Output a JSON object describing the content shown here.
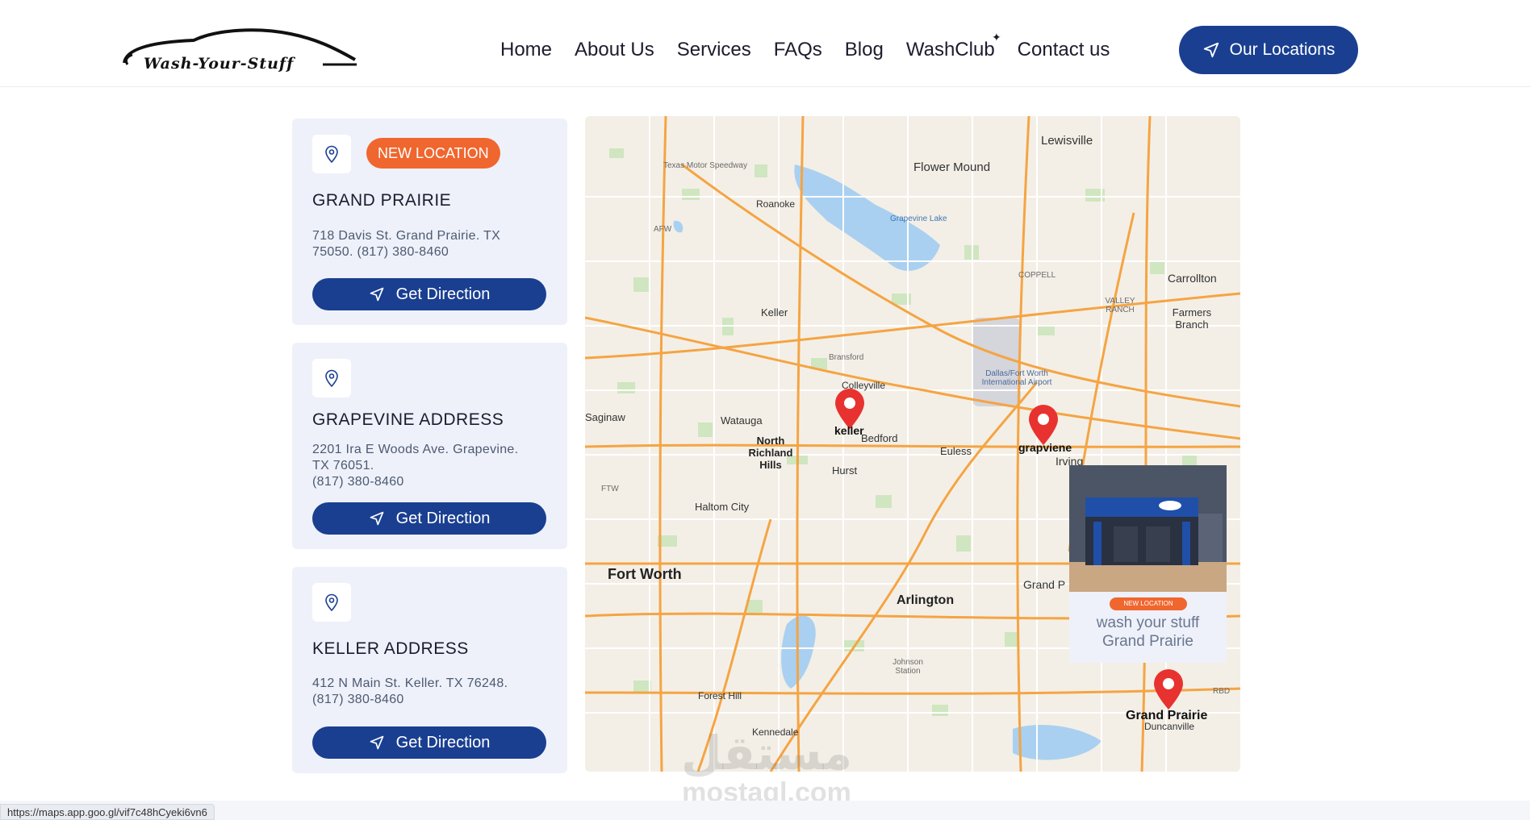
{
  "brand": {
    "logo_text": "Wash-Your-Stuff"
  },
  "nav": {
    "items": [
      "Home",
      "About Us",
      "Services",
      "FAQs",
      "Blog",
      "WashClub",
      "Contact us"
    ],
    "cta_label": "Our Locations"
  },
  "colors": {
    "primary": "#1a3f91",
    "accent": "#f0662f",
    "card_bg": "#eef1f9"
  },
  "locations": [
    {
      "badge": "NEW LOCATION",
      "title": "GRAND PRAIRIE",
      "address_lines": [
        "718 Davis St. Grand Prairie. TX",
        "75050. (817) 380-8460"
      ],
      "button_label": "Get Direction"
    },
    {
      "title": "GRAPEVINE ADDRESS",
      "address_lines": [
        "2201 Ira E Woods Ave. Grapevine.",
        "TX 76051.",
        "(817) 380-8460"
      ],
      "button_label": "Get Direction"
    },
    {
      "title": "KELLER ADDRESS",
      "address_lines": [
        "412 N Main St. Keller. TX 76248.",
        "(817) 380-8460"
      ],
      "button_label": "Get Direction"
    }
  ],
  "map": {
    "cities": {
      "lewisville": "Lewisville",
      "flower_mound": "Flower Mound",
      "roanoke": "Roanoke",
      "texas_motor": "Texas Motor Speedway",
      "grapevine_lake": "Grapevine Lake",
      "afw": "AFW",
      "coppell": "COPPELL",
      "carrollton": "Carrollton",
      "valley_ranch": "VALLEY RANCH",
      "farmers_branch": "Farmers Branch",
      "keller": "Keller",
      "bransford": "Bransford",
      "colleyville": "Colleyville",
      "dfw_airport": "Dallas/Fort Worth International Airport",
      "saginaw": "Saginaw",
      "watauga": "Watauga",
      "bedford": "Bedford",
      "euless": "Euless",
      "irving": "Irving",
      "north_richland_hills": "North Richland Hills",
      "hurst": "Hurst",
      "ftw": "FTW",
      "haltom_city": "Haltom City",
      "fort_worth": "Fort Worth",
      "grand_prairie_city": "Grand P",
      "arlington": "Arlington",
      "johnson_station": "Johnson Station",
      "forest_hill": "Forest Hill",
      "kennedale": "Kennedale",
      "rbd": "RBD",
      "duncanville": "Duncanville"
    },
    "markers": {
      "keller": "keller",
      "grapevine": "grapviene",
      "grand_prairie": "Grand Prairie"
    },
    "popup": {
      "badge": "NEW LOCATION",
      "line1": "wash your stuff",
      "line2": "Grand Prairie"
    }
  },
  "watermark": {
    "arabic": "مستقل",
    "english": "mostaql.com"
  },
  "status_url": "https://maps.app.goo.gl/vif7c48hCyeki6vn6"
}
